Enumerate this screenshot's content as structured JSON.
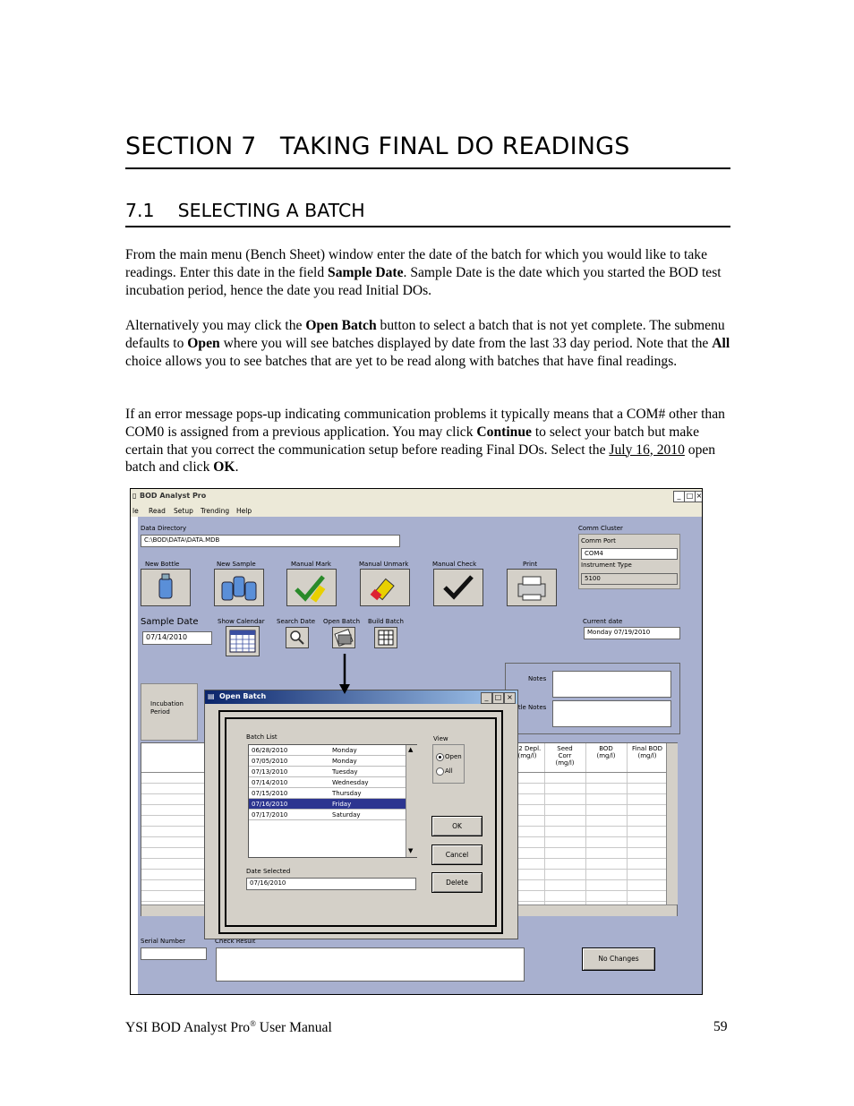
{
  "section_title": "SECTION 7   TAKING FINAL DO READINGS",
  "subsection_title": "7.1    SELECTING A BATCH",
  "para1": {
    "a": "From the main menu (Bench Sheet) window enter the date of the batch for which you would like to take readings. Enter this date in the field ",
    "b": "Sample Date",
    "c": ". Sample Date is the date which you started the BOD test incubation period, hence the date you read Initial DOs."
  },
  "para2": {
    "a": "Alternatively you may click the ",
    "b": "Open Batch",
    "c": " button to select a batch that is not yet complete. The submenu defaults to ",
    "d": "Open",
    "e": " where you will see batches displayed by date from the last 33 day period. Note that the ",
    "f": "All",
    "g": " choice allows you to see batches that are yet to be read along with batches that have final readings."
  },
  "para3": {
    "a": "If an error message pops-up indicating communication problems it typically means that a COM# other than COM0 is assigned from a previous application. You may click ",
    "b": "Continue",
    "c": " to select your batch but make certain that you correct the communication setup before reading Final DOs. Select the ",
    "d": "July 16, 2010",
    "e": " open batch and click ",
    "f": "OK",
    "g": "."
  },
  "app": {
    "title": "BOD Analyst Pro",
    "menu": [
      "le",
      "Read",
      "Setup",
      "Trending",
      "Help"
    ],
    "data_directory_label": "Data Directory",
    "data_directory_value": "C:\\BOD\\DATA\\DATA.MDB",
    "comm_cluster_label": "Comm Cluster",
    "comm_port_label": "Comm Port",
    "comm_port_value": "COM4",
    "instrument_type_label": "Instrument Type",
    "instrument_type_value": "5100",
    "tools": [
      "New Bottle",
      "New Sample",
      "Manual Mark",
      "Manual Unmark",
      "Manual Check",
      "Print"
    ],
    "sample_date_label": "Sample Date",
    "sample_date_value": "07/14/2010",
    "small_tools": [
      "Show Calendar",
      "Search Date",
      "Open Batch",
      "Build Batch"
    ],
    "current_date_label": "Current date",
    "current_date_value": "Monday 07/19/2010",
    "notes_label": "Notes",
    "bottle_notes_label": "Bottle Notes",
    "incubation_label": "Incubation Period",
    "columns": [
      "O2 Depl. (mg/l)",
      "Seed Corr (mg/l)",
      "BOD (mg/l)",
      "Final BOD (mg/l)"
    ],
    "serial_number_label": "Serial Number",
    "check_result_label": "Check Result",
    "no_changes_label": "No Changes"
  },
  "dialog": {
    "title": "Open Batch",
    "batch_list_label": "Batch List",
    "batches": [
      {
        "date": "06/28/2010",
        "day": "Monday"
      },
      {
        "date": "07/05/2010",
        "day": "Monday"
      },
      {
        "date": "07/13/2010",
        "day": "Tuesday"
      },
      {
        "date": "07/14/2010",
        "day": "Wednesday"
      },
      {
        "date": "07/15/2010",
        "day": "Thursday"
      },
      {
        "date": "07/16/2010",
        "day": "Friday"
      },
      {
        "date": "07/17/2010",
        "day": "Saturday"
      }
    ],
    "selected_index": 5,
    "view_label": "View",
    "view_open": "Open",
    "view_all": "All",
    "ok_label": "OK",
    "cancel_label": "Cancel",
    "delete_label": "Delete",
    "date_selected_label": "Date Selected",
    "date_selected_value": "07/16/2010"
  },
  "footer": {
    "left_a": "YSI BOD Analyst Pro",
    "reg": "®",
    "left_b": " User Manual",
    "page": "59"
  }
}
